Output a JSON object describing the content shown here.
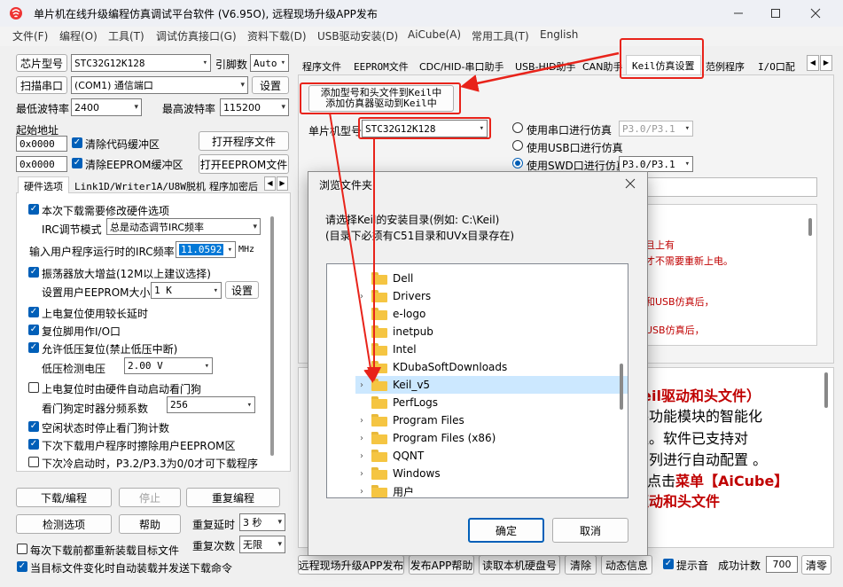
{
  "window": {
    "title": "单片机在线升级编程仿真调试平台软件 (V6.95O), 远程现场升级APP发布",
    "controls": [
      "minimize-icon",
      "maximize-icon",
      "close-icon"
    ]
  },
  "menu": [
    "文件(F)",
    "编程(O)",
    "工具(T)",
    "调试仿真接口(G)",
    "资料下载(D)",
    "USB驱动安装(D)",
    "AiCube(A)",
    "常用工具(T)",
    "English"
  ],
  "left": {
    "chip_label": "芯片型号",
    "chip_value": "STC32G12K128",
    "pins_label": "引脚数",
    "pins_value": "Auto",
    "scan_button": "扫描串口",
    "port_value": "(COM1) 通信端口",
    "settings_button": "设置",
    "min_baud_label": "最低波特率",
    "min_baud_value": "2400",
    "max_baud_label": "最高波特率",
    "max_baud_value": "115200",
    "start_addr_label": "起始地址",
    "addr1": "0x0000",
    "clear_code_label": "清除代码缓冲区",
    "open_prog_button": "打开程序文件",
    "addr2": "0x0000",
    "clear_eeprom_label": "清除EEPROM缓冲区",
    "open_eeprom_button": "打开EEPROM文件",
    "tabs": [
      "硬件选项",
      "Link1D/Writer1A/U8W脱机",
      "程序加密后"
    ],
    "hw": {
      "opt1": "本次下载需要修改硬件选项",
      "irc_mode_label": "IRC调节模式",
      "irc_mode_value": "总是动态调节IRC频率",
      "irc_freq_label": "输入用户程序运行时的IRC频率",
      "irc_freq_value": "11.0592",
      "irc_unit": "MHz",
      "osc_gain": "振荡器放大增益(12M以上建议选择)",
      "eeprom_size_label": "设置用户EEPROM大小",
      "eeprom_size_value": "1   K",
      "eeprom_set_button": "设置",
      "long_delay": "上电复位使用较长延时",
      "reset_io": "复位脚用作I/O口",
      "lvd_reset": "允许低压复位(禁止低压中断)",
      "lvd_voltage_label": "低压检测电压",
      "lvd_voltage_value": "2.00 V",
      "wdt_auto": "上电复位时由硬件自动启动看门狗",
      "wdt_div_label": "看门狗定时器分频系数",
      "wdt_div_value": "256",
      "idle_wdt": "空闲状态时停止看门狗计数",
      "erase_eeprom": "下次下载用户程序时擦除用户EEPROM区",
      "cold_boot": "下次冷启动时，P3.2/P3.3为0/0才可下载程序"
    },
    "download_button": "下载/编程",
    "stop_button": "停止",
    "reprogram_button": "重复编程",
    "check_button": "检测选项",
    "help_button": "帮助",
    "repeat_delay_label": "重复延时",
    "repeat_delay_value": "3 秒",
    "repeat_count_label": "重复次数",
    "repeat_count_value": "无限",
    "reload_label": "每次下载前都重新装载目标文件",
    "auto_load_label": "当目标文件变化时自动装载并发送下载命令"
  },
  "right": {
    "tabs": [
      "程序文件",
      "EEPROM文件",
      "CDC/HID-串口助手",
      "USB-HID助手",
      "CAN助手",
      "Keil仿真设置",
      "范例程序",
      "I/O口配"
    ],
    "add_keil_button_line1": "添加型号和头文件到Keil中",
    "add_keil_button_line2": "添加仿真器驱动到Keil中",
    "mcu_label": "单片机型号",
    "mcu_value": "STC32G12K128",
    "sim_serial": "使用串口进行仿真",
    "sim_serial_port": "P3.0/P3.1",
    "sim_usb": "使用USB口进行仿真",
    "sim_swd": "使用SWD口进行仿真",
    "sim_swd_port": "P3.0/P3.1",
    "info_line1": "且上有",
    "info_line2": "才不需要重新上电。",
    "info_line3": "和USB仿真后，",
    "info_line4": "USB仿真后，",
    "big_line1": "Keil驱动和头文件）",
    "big_line2": "各功能模块的智能化",
    "big_line3": "议。软件已支持对",
    "big_line4": "系列进行自动配置 。",
    "big_line5_a": "点击",
    "big_line5_b": "菜单【AiCube】",
    "big_line6": "驱动和头文件",
    "bottom_buttons": [
      "远程现场升级APP发布",
      "发布APP帮助",
      "读取本机硬盘号",
      "清除",
      "动态信息"
    ],
    "beep_label": "提示音",
    "success_label": "成功计数",
    "success_value": "700",
    "clear_button": "清零"
  },
  "dialog": {
    "title": "浏览文件夹",
    "prompt1": "请选择Keil的安装目录(例如: C:\\Keil)",
    "prompt2": "(目录下必须有C51目录和UVx目录存在)",
    "folders": [
      {
        "name": "Dell",
        "chevron": false
      },
      {
        "name": "Drivers",
        "chevron": true
      },
      {
        "name": "e-logo",
        "chevron": false
      },
      {
        "name": "inetpub",
        "chevron": false
      },
      {
        "name": "Intel",
        "chevron": false
      },
      {
        "name": "KDubaSoftDownloads",
        "chevron": false
      },
      {
        "name": "Keil_v5",
        "chevron": true
      },
      {
        "name": "PerfLogs",
        "chevron": false
      },
      {
        "name": "Program Files",
        "chevron": true
      },
      {
        "name": "Program Files (x86)",
        "chevron": true
      },
      {
        "name": "QQNT",
        "chevron": true
      },
      {
        "name": "Windows",
        "chevron": true
      },
      {
        "name": "用户",
        "chevron": true
      }
    ],
    "selected": "Keil_v5",
    "ok_button": "确定",
    "cancel_button": "取消"
  },
  "colors": {
    "accent": "#005fb8",
    "annotation": "#e8231a",
    "highlight_red": "#c00000"
  }
}
